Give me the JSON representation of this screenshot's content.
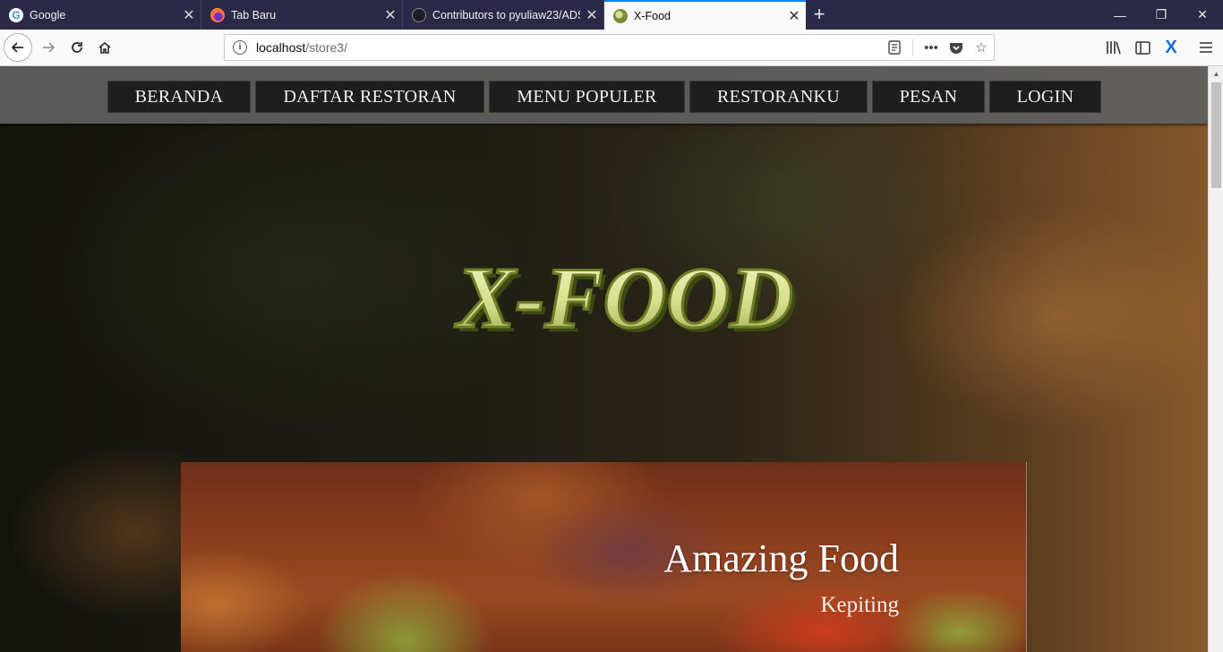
{
  "browser": {
    "tabs": [
      {
        "label": "Google",
        "icon": "google-icon"
      },
      {
        "label": "Tab Baru",
        "icon": "firefox-icon"
      },
      {
        "label": "Contributors to pyuliaw23/ADS",
        "icon": "github-icon"
      },
      {
        "label": "X-Food",
        "icon": "xfood-icon",
        "active": true
      }
    ],
    "new_tab_symbol": "+",
    "url_host": "localhost",
    "url_path": "/store3/",
    "accent_color": "#0a84ff"
  },
  "site": {
    "nav": [
      "BERANDA",
      "DAFTAR RESTORAN",
      "MENU POPULER",
      "RESTORANKU",
      "PESAN",
      "LOGIN"
    ],
    "logo_text": "X-FOOD",
    "slide": {
      "title": "Amazing Food",
      "subtitle": "Kepiting"
    }
  }
}
